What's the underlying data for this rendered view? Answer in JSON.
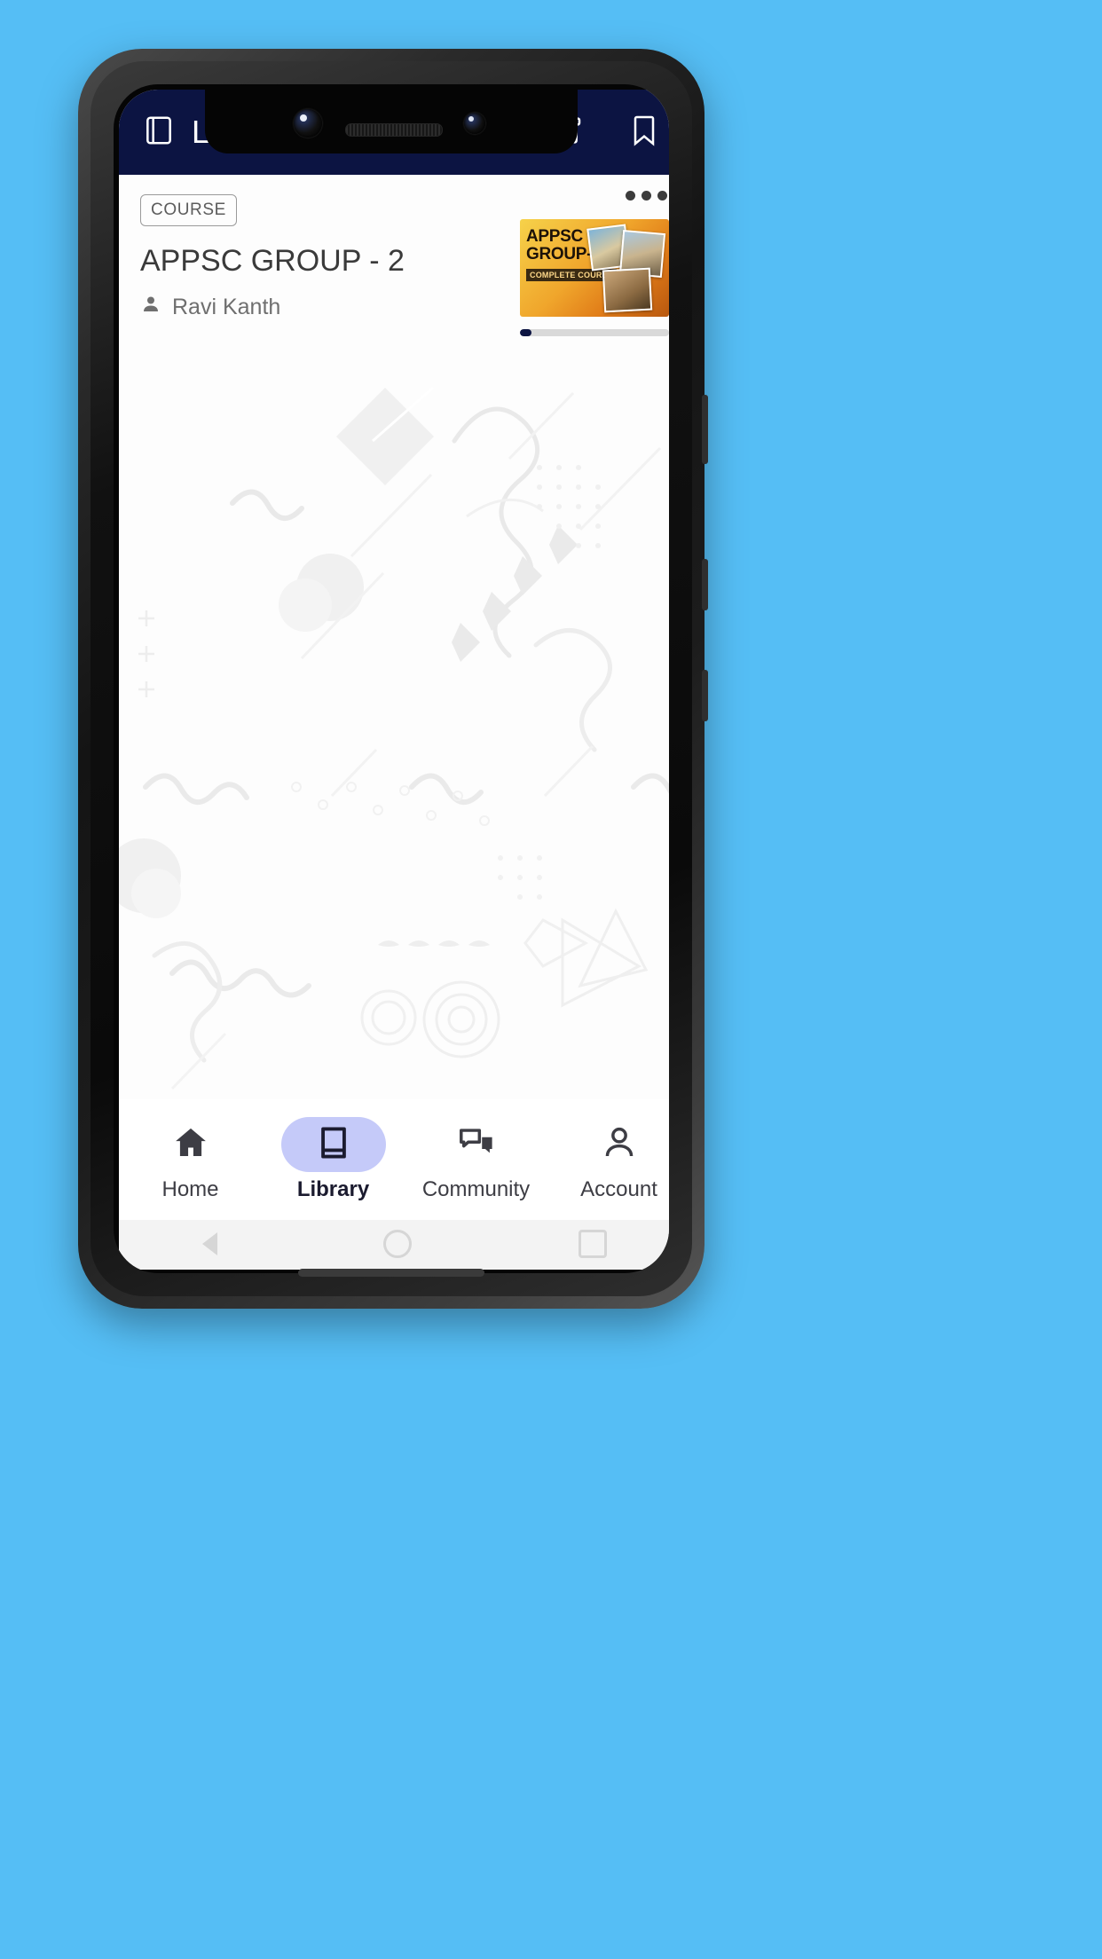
{
  "background_color": "#55bef5",
  "header": {
    "title": "Library",
    "icons": {
      "leading": "book-icon",
      "archive": "archive-icon",
      "bookmark": "bookmark-icon"
    },
    "background_color": "#0c1442",
    "text_color": "#ffffff"
  },
  "course_card": {
    "badge": "COURSE",
    "title": "APPSC GROUP - 2",
    "author": "Ravi Kanth",
    "author_icon": "person-icon",
    "overflow_icon": "more-options-icon",
    "thumbnail": {
      "line1": "APPSC",
      "line2": "GROUP-2",
      "ribbon": "COMPLETE COURSE"
    },
    "progress_percent": 8,
    "progress_color": "#0c1442",
    "progress_track_color": "#d9d9d9"
  },
  "bottom_nav": {
    "active_index": 1,
    "active_pill_color": "#c5caf9",
    "items": [
      {
        "label": "Home",
        "icon": "home-icon"
      },
      {
        "label": "Library",
        "icon": "book-icon"
      },
      {
        "label": "Community",
        "icon": "chat-bubbles-icon"
      },
      {
        "label": "Account",
        "icon": "person-outline-icon"
      }
    ]
  }
}
